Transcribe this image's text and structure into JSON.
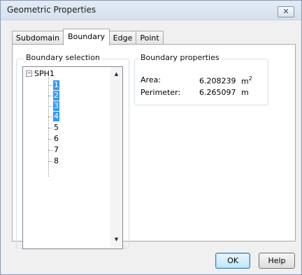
{
  "window": {
    "title": "Geometric Properties",
    "close_glyph": "✕"
  },
  "tabs": [
    {
      "label": "Subdomain",
      "active": false
    },
    {
      "label": "Boundary",
      "active": true
    },
    {
      "label": "Edge",
      "active": false
    },
    {
      "label": "Point",
      "active": false
    }
  ],
  "boundary_selection": {
    "group_label": "Boundary selection",
    "root": {
      "label": "SPH1",
      "expander": "−",
      "expanded": true
    },
    "items": [
      {
        "label": "1",
        "selected": true
      },
      {
        "label": "2",
        "selected": true
      },
      {
        "label": "3",
        "selected": true
      },
      {
        "label": "4",
        "selected": true
      },
      {
        "label": "5",
        "selected": false
      },
      {
        "label": "6",
        "selected": false
      },
      {
        "label": "7",
        "selected": false
      },
      {
        "label": "8",
        "selected": false
      }
    ],
    "scroll_up_glyph": "▲",
    "scroll_down_glyph": "▼"
  },
  "boundary_properties": {
    "group_label": "Boundary properties",
    "area": {
      "label": "Area:",
      "value": "6.208239",
      "unit": "m",
      "unit_superscript": "2"
    },
    "perimeter": {
      "label": "Perimeter:",
      "value": "6.265097",
      "unit": "m"
    }
  },
  "buttons": {
    "ok": "OK",
    "help": "Help"
  },
  "icons": {
    "close": "close-icon",
    "expander": "tree-collapse-icon",
    "scroll_up": "scroll-up-arrow-icon",
    "scroll_down": "scroll-down-arrow-icon"
  }
}
